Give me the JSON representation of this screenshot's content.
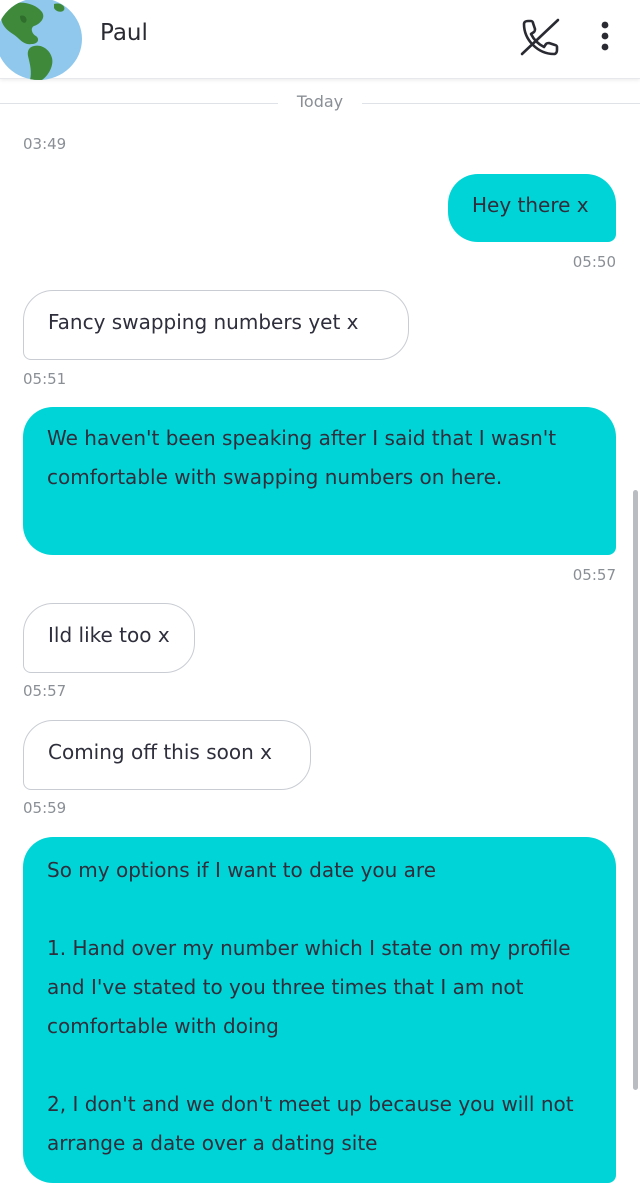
{
  "header": {
    "contact_name": "Paul"
  },
  "divider": {
    "label": "Today"
  },
  "icons": {
    "avatar": "globe-image",
    "call": "phone-off-icon",
    "more": "more-vertical-icon"
  },
  "colors": {
    "outgoing_bubble": "#00d4d6",
    "incoming_border": "#c9cdd3",
    "timestamp": "#8a8f96"
  },
  "messages": [
    {
      "direction": "time",
      "time": "03:49"
    },
    {
      "direction": "out",
      "text": "Hey there x",
      "time": "05:50"
    },
    {
      "direction": "in",
      "text": "Fancy swapping numbers yet x",
      "time": "05:51"
    },
    {
      "direction": "out",
      "text": "We haven't been speaking after I said that I wasn't comfortable with swapping numbers on here.",
      "time": "05:57"
    },
    {
      "direction": "in",
      "text": "Ild like too x",
      "time": "05:57"
    },
    {
      "direction": "in",
      "text": "Coming off this soon x",
      "time": "05:59"
    },
    {
      "direction": "out",
      "text": "So my options if I want to date you are\n\n1. Hand over my number which I state on my profile and I've stated to you three times that I am not comfortable with doing\n\n2, I don't and we don't meet up because you will not arrange a date over a dating site"
    }
  ]
}
